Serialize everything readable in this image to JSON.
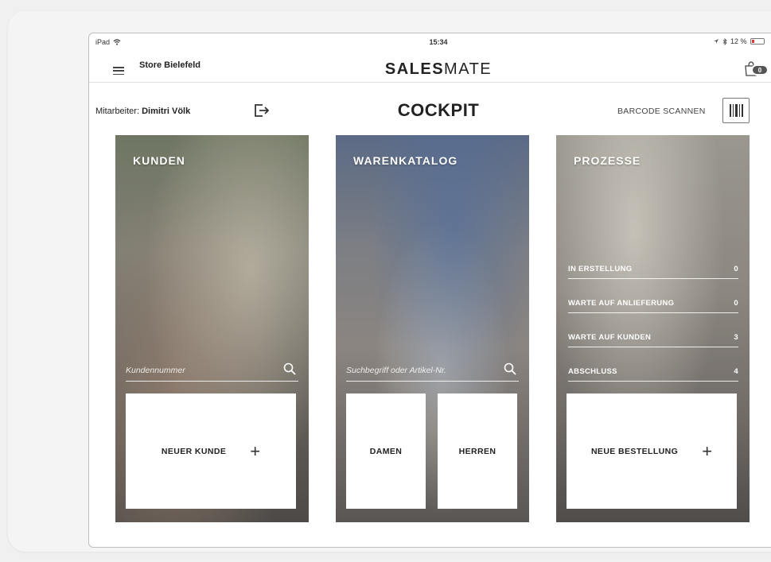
{
  "status_bar": {
    "device": "iPad",
    "time": "15:34",
    "battery": "12 %"
  },
  "header": {
    "store_name": "Store Bielefeld",
    "logo_bold": "SALES",
    "logo_light": "MATE",
    "cart_count": "0"
  },
  "toolbar": {
    "employee_label": "Mitarbeiter:",
    "employee_name": "Dimitri Völk",
    "page_title": "COCKPIT",
    "barcode_label": "BARCODE SCANNEN"
  },
  "panels": {
    "kunden": {
      "title": "KUNDEN",
      "search_placeholder": "Kundennummer",
      "new_button_label": "NEUER KUNDE",
      "plus": "+"
    },
    "warenkatalog": {
      "title": "WARENKATALOG",
      "search_placeholder": "Suchbegriff oder Artikel-Nr.",
      "tiles": [
        "DAMEN",
        "HERREN"
      ]
    },
    "prozesse": {
      "title": "PROZESSE",
      "rows": [
        {
          "label": "IN ERSTELLUNG",
          "count": "0"
        },
        {
          "label": "WARTE AUF ANLIEFERUNG",
          "count": "0"
        },
        {
          "label": "WARTE AUF KUNDEN",
          "count": "3"
        },
        {
          "label": "ABSCHLUSS",
          "count": "4"
        }
      ],
      "new_button_label": "NEUE BESTELLUNG",
      "plus": "+"
    }
  }
}
